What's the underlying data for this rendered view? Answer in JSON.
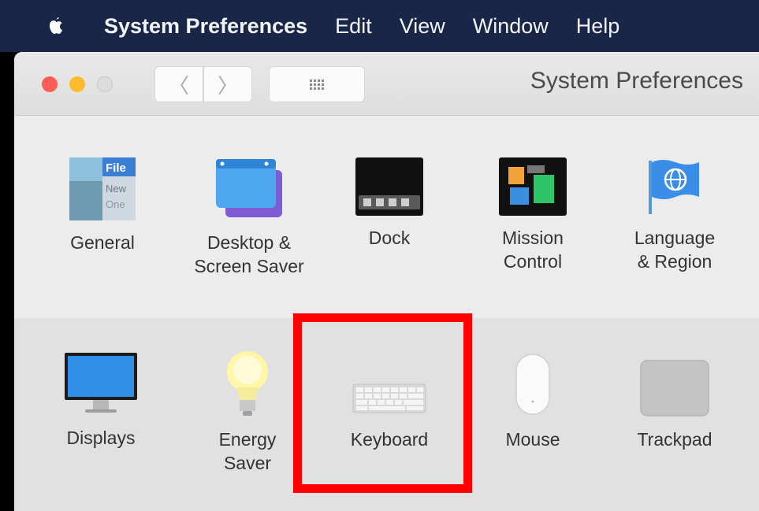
{
  "menubar": {
    "app_name": "System Preferences",
    "items": [
      "Edit",
      "View",
      "Window",
      "Help"
    ]
  },
  "window": {
    "title": "System Preferences",
    "nav": {
      "back": "〈",
      "forward": "〉"
    }
  },
  "general_icon_text": [
    "File",
    "New",
    "One"
  ],
  "panes_row1": [
    {
      "name": "General"
    },
    {
      "name": "Desktop & Screen Saver",
      "lines": [
        "Desktop &",
        "Screen Saver"
      ]
    },
    {
      "name": "Dock"
    },
    {
      "name": "Mission Control",
      "lines": [
        "Mission",
        "Control"
      ]
    },
    {
      "name": "Language & Region",
      "lines": [
        "Language",
        "& Region"
      ]
    }
  ],
  "panes_row2": [
    {
      "name": "Displays"
    },
    {
      "name": "Energy Saver",
      "lines": [
        "Energy",
        "Saver"
      ]
    },
    {
      "name": "Keyboard"
    },
    {
      "name": "Mouse"
    },
    {
      "name": "Trackpad"
    }
  ],
  "colors": {
    "menubar_bg": "#1a2648",
    "highlight_border": "#ff0000",
    "close": "#fc5d56",
    "minimize": "#fdbc2e"
  }
}
